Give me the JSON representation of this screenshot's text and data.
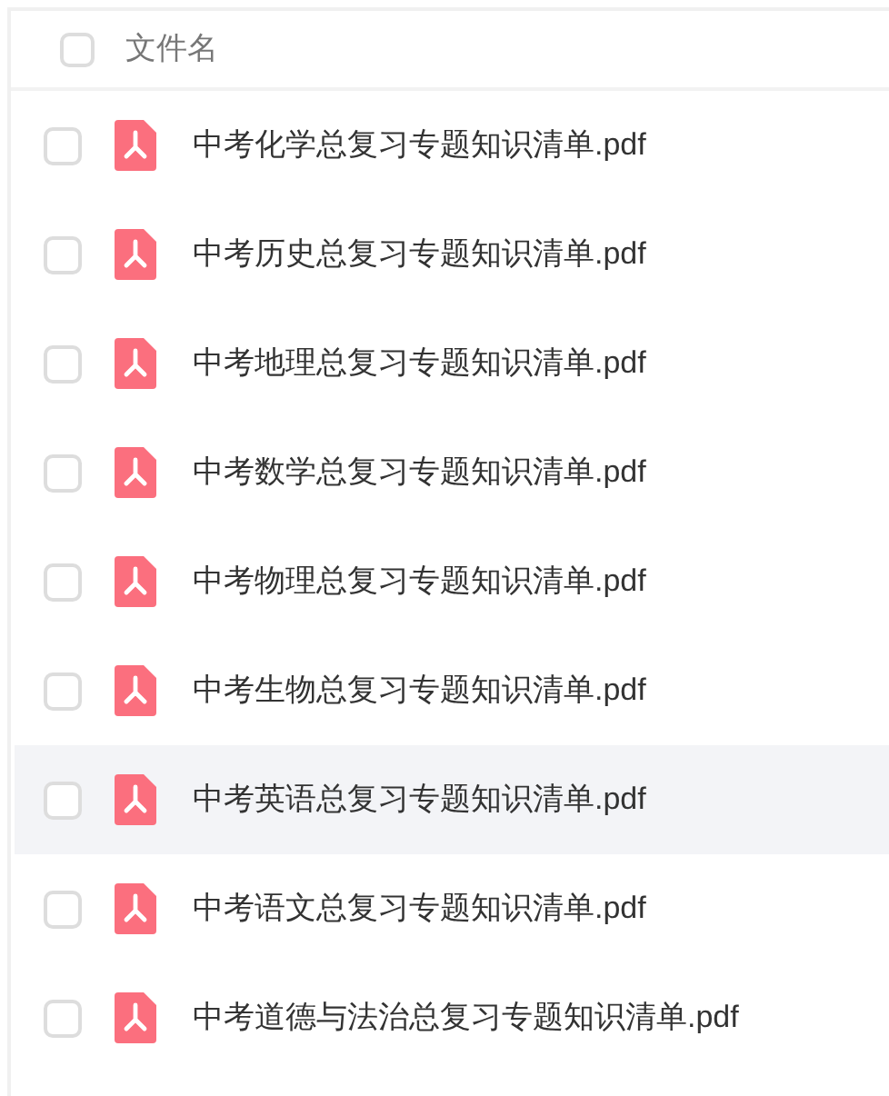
{
  "header": {
    "checked": false,
    "label": "文件名"
  },
  "files": [
    {
      "name": "中考化学总复习专题知识清单.pdf",
      "checked": false,
      "hovered": false
    },
    {
      "name": "中考历史总复习专题知识清单.pdf",
      "checked": false,
      "hovered": false
    },
    {
      "name": "中考地理总复习专题知识清单.pdf",
      "checked": false,
      "hovered": false
    },
    {
      "name": "中考数学总复习专题知识清单.pdf",
      "checked": false,
      "hovered": false
    },
    {
      "name": "中考物理总复习专题知识清单.pdf",
      "checked": false,
      "hovered": false
    },
    {
      "name": "中考生物总复习专题知识清单.pdf",
      "checked": false,
      "hovered": false
    },
    {
      "name": "中考英语总复习专题知识清单.pdf",
      "checked": false,
      "hovered": true
    },
    {
      "name": "中考语文总复习专题知识清单.pdf",
      "checked": false,
      "hovered": false
    },
    {
      "name": "中考道德与法治总复习专题知识清单.pdf",
      "checked": false,
      "hovered": false
    }
  ]
}
